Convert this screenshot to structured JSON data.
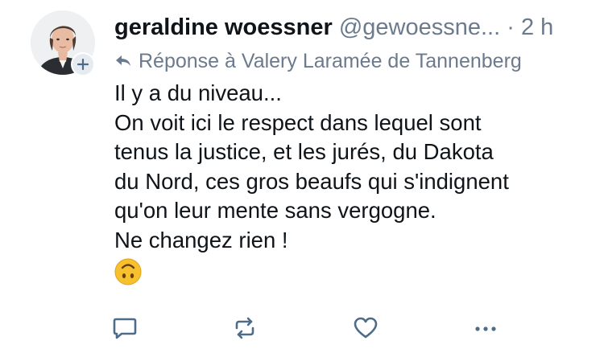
{
  "post": {
    "author_name": "geraldine woessner",
    "author_handle": "@gewoessne...",
    "separator": "·",
    "time": "2 h",
    "reply_to": "Réponse à Valery Laramée de Tannenberg",
    "content_lines": [
      "Il y a du niveau...",
      "On voit ici le respect dans lequel sont",
      "tenus la justice, et les jurés, du Dakota",
      "du Nord, ces gros beaufs qui s'indignent",
      "qu'on leur mente sans vergogne.",
      "Ne changez rien !"
    ],
    "emoji": "upside-down-face"
  },
  "icons": {
    "follow": "plus-icon",
    "reply_arrow": "reply-arrow-icon",
    "comment": "comment-icon",
    "boost": "boost-icon",
    "like": "heart-icon",
    "more": "more-icon"
  },
  "colors": {
    "text": "#0f1419",
    "muted": "#6b7a8c",
    "icon": "#4e6c8a",
    "emoji_face": "#f7c02e"
  }
}
